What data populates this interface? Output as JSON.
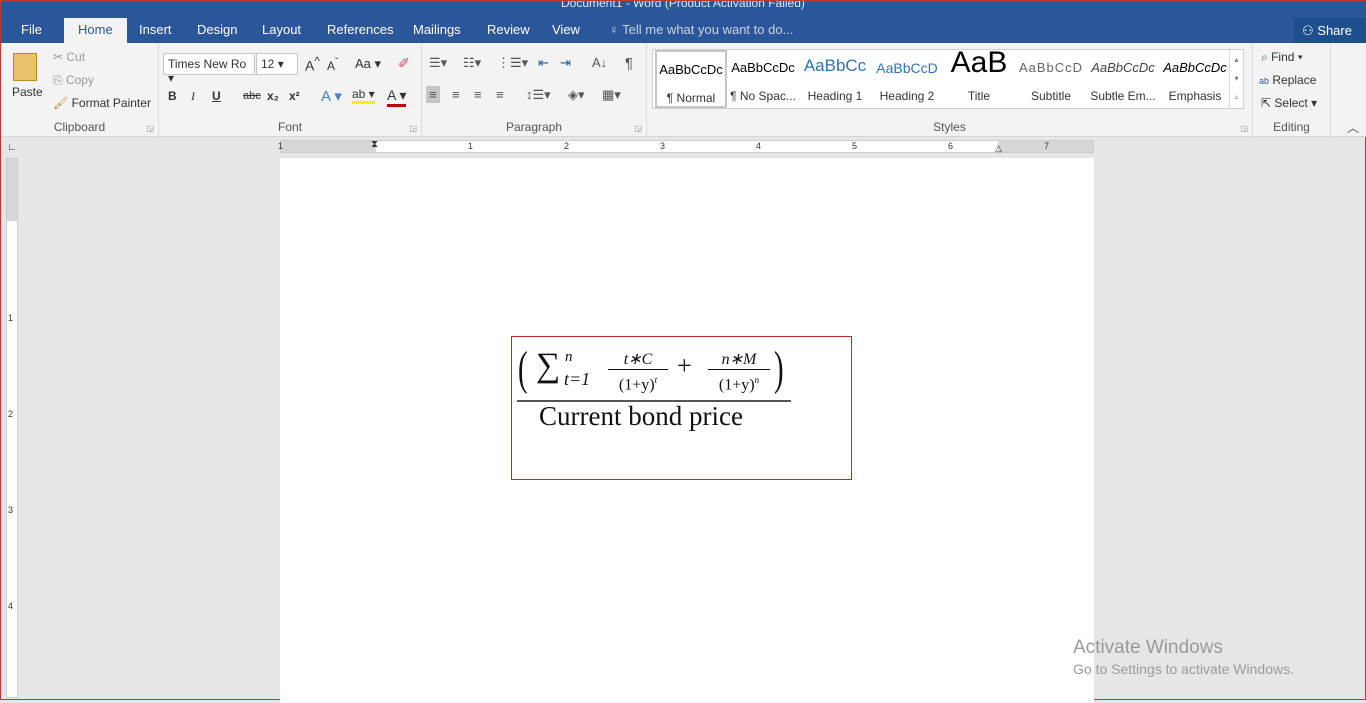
{
  "window": {
    "title": "Document1 - Word (Product Activation Failed)"
  },
  "tabs": [
    "File",
    "Home",
    "Insert",
    "Design",
    "Layout",
    "References",
    "Mailings",
    "Review",
    "View"
  ],
  "tell_me": "Tell me what you want to do...",
  "share": "Share",
  "clipboard": {
    "paste": "Paste",
    "cut": "Cut",
    "copy": "Copy",
    "format_painter": "Format Painter",
    "label": "Clipboard"
  },
  "font": {
    "name": "Times New Ro",
    "size": "12",
    "change_case": "Aa",
    "bold": "B",
    "italic": "I",
    "underline": "U",
    "strike": "abc",
    "sub": "x₂",
    "sup": "x²",
    "label": "Font"
  },
  "paragraph": {
    "label": "Paragraph"
  },
  "styles": {
    "label": "Styles",
    "items": [
      {
        "preview": "AaBbCcDc",
        "name": "¶ Normal"
      },
      {
        "preview": "AaBbCcDc",
        "name": "¶ No Spac..."
      },
      {
        "preview": "AaBbCc",
        "name": "Heading 1"
      },
      {
        "preview": "AaBbCcD",
        "name": "Heading 2"
      },
      {
        "preview": "AaB",
        "name": "Title"
      },
      {
        "preview": "AaBbCcD",
        "name": "Subtitle"
      },
      {
        "preview": "AaBbCcDc",
        "name": "Subtle Em..."
      },
      {
        "preview": "AaBbCcDc",
        "name": "Emphasis"
      }
    ]
  },
  "editing": {
    "find": "Find",
    "replace": "Replace",
    "select": "Select",
    "label": "Editing"
  },
  "ruler": [
    "1",
    "1",
    "2",
    "3",
    "4",
    "5",
    "6",
    "7"
  ],
  "vruler": [
    "1",
    "2",
    "3",
    "4"
  ],
  "equation": {
    "sum": "∑",
    "upper": "n",
    "lower": "t=1",
    "num1": "t∗C",
    "den1": "(1+y)",
    "exp1": "t",
    "plus": "+",
    "num2": "n∗M",
    "den2": "(1+y)",
    "exp2": "n",
    "denominator": "Current bond price"
  },
  "watermark": {
    "line1": "Activate Windows",
    "line2": "Go to Settings to activate Windows."
  }
}
